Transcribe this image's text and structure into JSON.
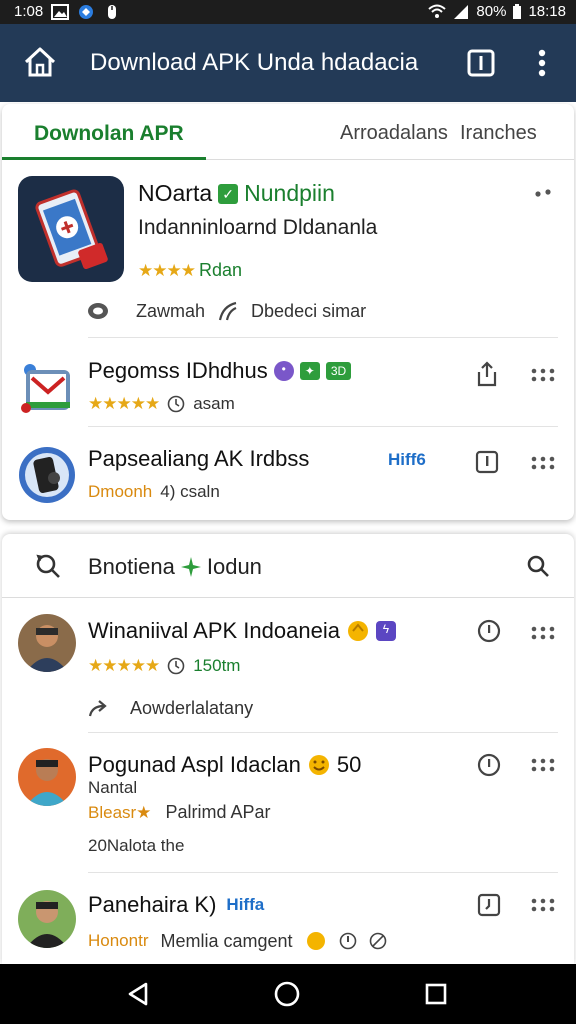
{
  "status_bar": {
    "time": "1:08",
    "battery": "80%",
    "clock_right": "18:18"
  },
  "app_bar": {
    "title": "Download APK Unda hdadacia"
  },
  "tabs": [
    {
      "label": "Downolan APR",
      "active": true
    },
    {
      "label": "Arroadalans",
      "active": false
    },
    {
      "label": "Iranches",
      "active": false
    }
  ],
  "featured": {
    "title_a": "NOarta",
    "title_b": "Nundpiin",
    "subtitle": "Indanninloarnd Dldananla",
    "stars": "★★★★",
    "rating_text": "Rdan",
    "meta_1": "Zawmah",
    "meta_2": "Dbedeci simar"
  },
  "apps": [
    {
      "title": "Pegomss IDhdhus",
      "badge_1": "•",
      "badge_2": "✦",
      "badge_3": "3D",
      "stars": "★★★★★",
      "meta": "asam"
    },
    {
      "title": "Papsealiang AK Irdbss",
      "tag": "Hiff6",
      "meta_orange": "Dmoonh",
      "meta": "4) csaln"
    }
  ],
  "section": {
    "title_a": "Bnotiena",
    "title_b": "Iodun"
  },
  "posts": [
    {
      "title": "Winaniival APK Indoaneia",
      "stars": "★★★★★",
      "meta": "150tm",
      "sub": "Aowderlalatany"
    },
    {
      "title": "Pogunad Aspl Idaclan",
      "count": "50",
      "sub_line": "Nantal",
      "meta_orange": "Bleasr★",
      "meta": "Palrimd APar",
      "footer": "20Nalota the"
    },
    {
      "title": "Panehaira K)",
      "tag": "Hiffa",
      "meta_orange": "Honontr",
      "meta": "Memlia camgent"
    }
  ],
  "colors": {
    "appbar": "#233a57",
    "accent_green": "#1a7f2e",
    "star": "#e6a817",
    "link_blue": "#1e6ec8"
  }
}
